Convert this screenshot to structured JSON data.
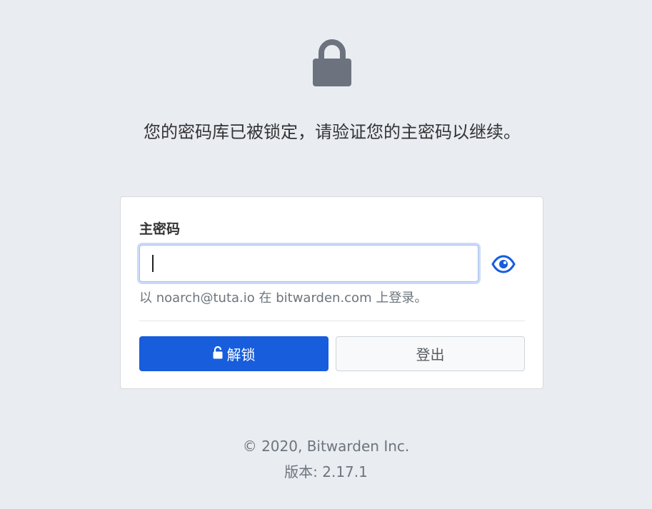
{
  "lock": {
    "icon": "lock-icon",
    "color": "#6c737f"
  },
  "message": "您的密码库已被锁定，请验证您的主密码以继续。",
  "form": {
    "label": "主密码",
    "password_value": "",
    "show_password_icon": "eye-icon",
    "hint": "以 noarch@tuta.io 在 bitwarden.com 上登录。",
    "unlock_label": "解锁",
    "unlock_icon": "unlock-icon",
    "logout_label": "登出"
  },
  "footer": {
    "copyright": "© 2020, Bitwarden Inc.",
    "version": "版本: 2.17.1"
  },
  "colors": {
    "background": "#e9ecf1",
    "primary": "#175ddc",
    "muted": "#6c757d"
  }
}
